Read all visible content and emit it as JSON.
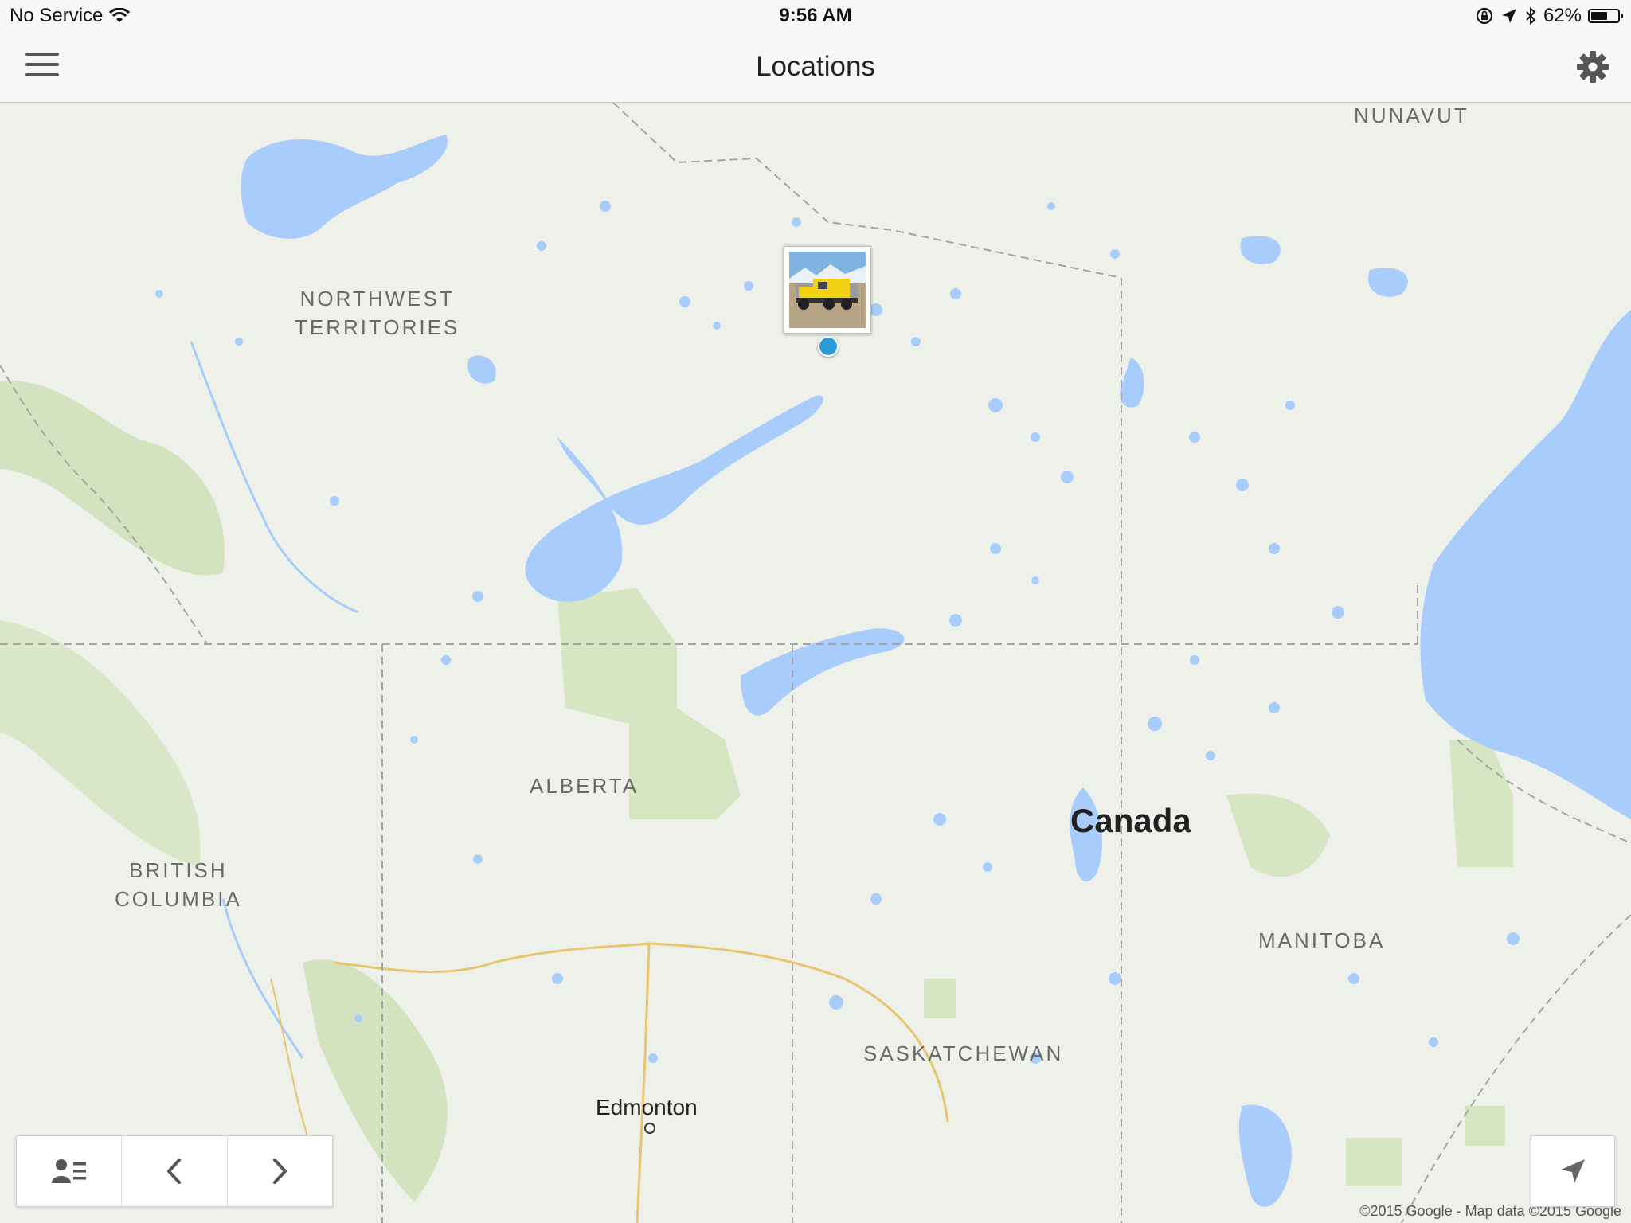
{
  "status_bar": {
    "carrier": "No Service",
    "time": "9:56 AM",
    "battery_percent_text": "62%",
    "battery_level": 0.62,
    "icons": [
      "wifi-icon",
      "rotation-lock-icon",
      "location-arrow-icon",
      "bluetooth-icon",
      "battery-icon"
    ]
  },
  "nav": {
    "title": "Locations",
    "left_icon": "hamburger-menu-icon",
    "right_icon": "gear-icon"
  },
  "map": {
    "regions": {
      "nunavut": "NUNAVUT",
      "northwest_territories_1": "NORTHWEST",
      "northwest_territories_2": "TERRITORIES",
      "alberta": "ALBERTA",
      "british_columbia_1": "BRITISH",
      "british_columbia_2": "COLUMBIA",
      "saskatchewan": "SASKATCHEWAN",
      "manitoba": "MANITOBA"
    },
    "country": "Canada",
    "city": "Edmonton",
    "attribution": "©2015 Google - Map data ©2015 Google",
    "colors": {
      "water": "#a8cdfd",
      "land": "#eef0ea",
      "park": "#d6e5c2",
      "border": "#a9a9a9",
      "pin": "#2a9ad8"
    }
  },
  "pin": {
    "thumbnail": "yellow-truck-photo"
  },
  "toolbar": {
    "buttons": [
      "contact-list-icon",
      "chevron-left-icon",
      "chevron-right-icon"
    ]
  },
  "locate": {
    "icon": "navigation-arrow-icon"
  }
}
